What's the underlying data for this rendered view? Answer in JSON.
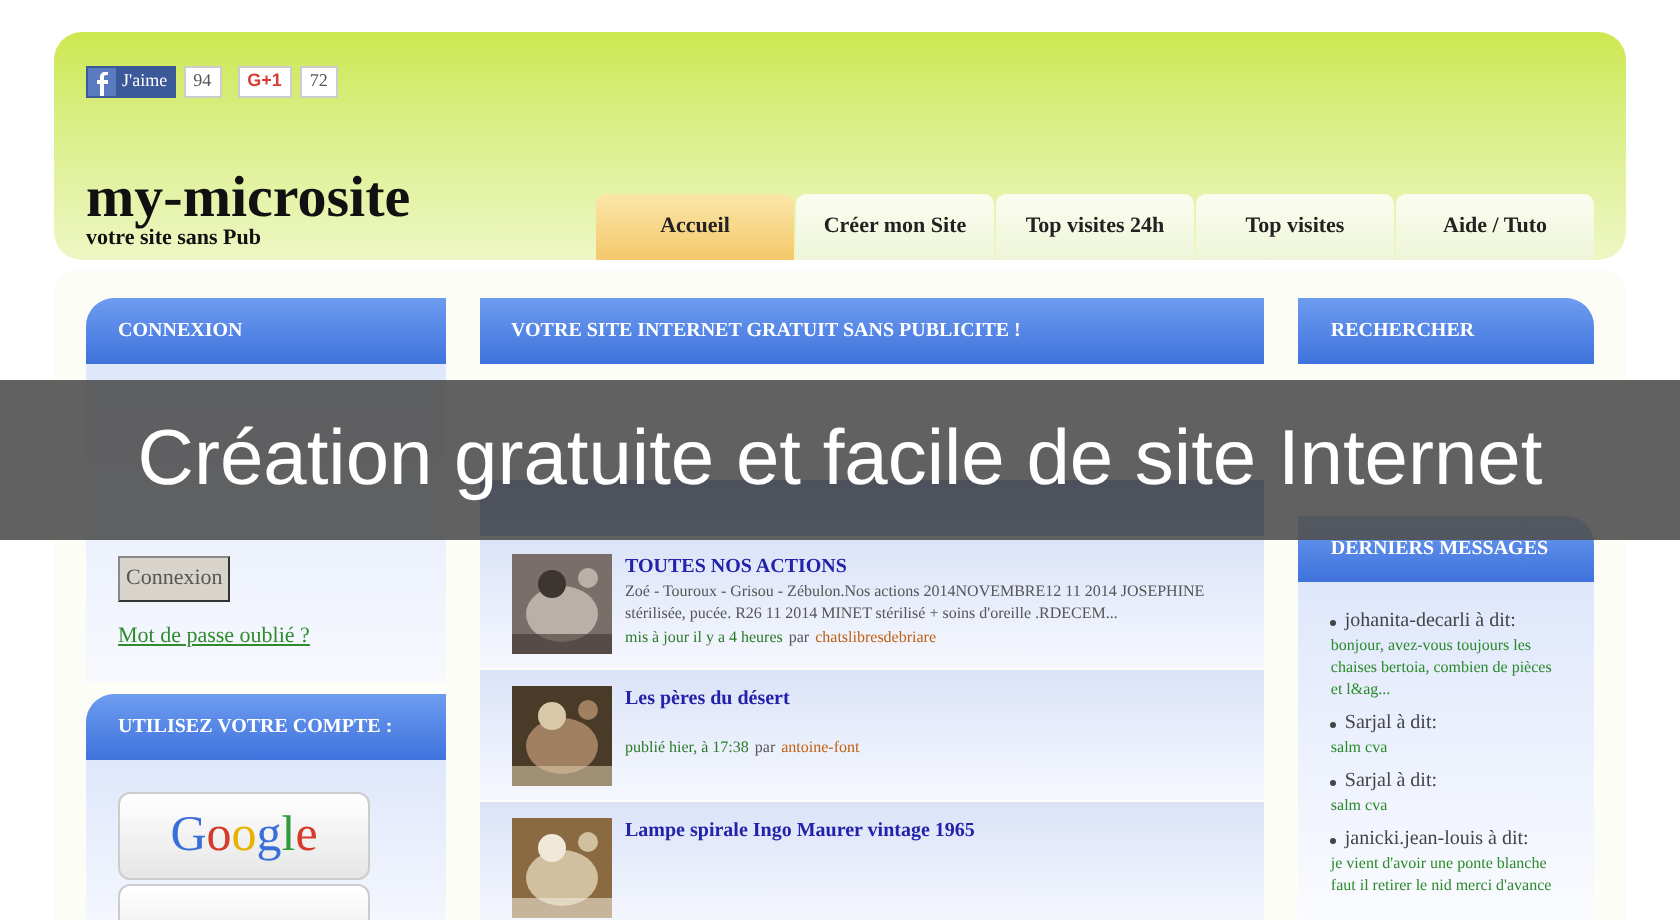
{
  "social": [
    {
      "kind": "facebook",
      "label": "J'aime",
      "count": "94"
    },
    {
      "kind": "gplus",
      "label": "G+1",
      "count": "72"
    }
  ],
  "site": {
    "title": "my-microsite",
    "tagline": "votre site sans Pub"
  },
  "tabs": [
    {
      "label": "Accueil",
      "selected": true
    },
    {
      "label": "Créer mon Site",
      "selected": false
    },
    {
      "label": "Top visites 24h",
      "selected": false
    },
    {
      "label": "Top visites",
      "selected": false
    },
    {
      "label": "Aide / Tuto",
      "selected": false
    }
  ],
  "banner": "Création gratuite et facile de site Internet",
  "login": {
    "title": "CONNEXION",
    "button": "Connexion",
    "forgot_link": "Mot de passe oublié ?"
  },
  "account": {
    "title": "UTILISEZ VOTRE COMPTE :",
    "providers": [
      "Google"
    ]
  },
  "main": {
    "title": "VOTRE SITE INTERNET GRATUIT SANS PUBLICITE !",
    "items": [
      {
        "title": "TOUTES NOS ACTIONS",
        "description": "Zoé - Touroux - Grisou - Zébulon.Nos actions 2014NOVEMBRE12 11 2014 JOSEPHINE stérilisée, pucée. R26 11 2014 MINET stérilisé + soins d'oreille .RDECEM...",
        "updated": "mis à jour il y a 4 heures",
        "by": "par",
        "author": "chatslibresdebriare"
      },
      {
        "title": "Les pères du désert",
        "updated": "publié hier, à 17:38",
        "by": "par",
        "author": "antoine-font"
      },
      {
        "title": "Lampe spirale Ingo Maurer vintage 1965"
      }
    ]
  },
  "search": {
    "title": "RECHERCHER"
  },
  "messages": {
    "title": "DERNIERS MESSAGES",
    "items": [
      {
        "author": "johanita-decarli à dit:",
        "text": "bonjour, avez-vous toujours les chaises bertoia, combien de pièces et l&ag..."
      },
      {
        "author": "Sarjal à dit:",
        "text": "salm cva"
      },
      {
        "author": "Sarjal à dit:",
        "text": "salm cva"
      },
      {
        "author": "janicki.jean-louis à dit:",
        "text": "je vient d'avoir une ponte blanche faut il retirer le nid merci d'avance"
      }
    ]
  }
}
